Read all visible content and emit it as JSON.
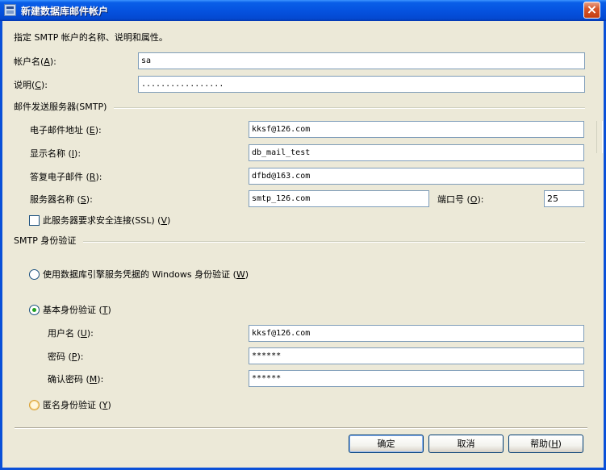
{
  "window": {
    "title": "新建数据库邮件帐户",
    "close_label": "×"
  },
  "intro": "指定 SMTP 帐户的名称、说明和属性。",
  "account": {
    "name_label": "帐户名",
    "name_key": "A",
    "name_value": "sa",
    "desc_label": "说明",
    "desc_key": "C",
    "desc_value": "................."
  },
  "smtp_server": {
    "group_title": "邮件发送服务器(SMTP)",
    "email_label": "电子邮件地址",
    "email_key": "E",
    "email_value": "kksf@126.com",
    "display_label": "显示名称",
    "display_key": "I",
    "display_value": "db_mail_test",
    "reply_label": "答复电子邮件",
    "reply_key": "R",
    "reply_value": "dfbd@163.com",
    "server_label": "服务器名称",
    "server_key": "S",
    "server_value": "smtp_126.com",
    "port_label": "端口号",
    "port_key": "O",
    "port_value": "25",
    "ssl_label": "此服务器要求安全连接(SSL)",
    "ssl_key": "V",
    "ssl_checked": false
  },
  "auth": {
    "group_title": "SMTP 身份验证",
    "windows_label": "使用数据库引擎服务凭据的 Windows 身份验证",
    "windows_key": "W",
    "basic_label": "基本身份验证",
    "basic_key": "T",
    "selected": "basic",
    "username_label": "用户名",
    "username_key": "U",
    "username_value": "kksf@126.com",
    "password_label": "密码",
    "password_key": "P",
    "password_value": "******",
    "confirm_label": "确认密码",
    "confirm_key": "M",
    "confirm_value": "******",
    "anonymous_label": "匿名身份验证",
    "anonymous_key": "Y"
  },
  "buttons": {
    "ok": "确定",
    "cancel": "取消",
    "help_label": "帮助",
    "help_key": "H"
  },
  "colors": {
    "title_bar": "#0553e0",
    "dialog_bg": "#ece9d8",
    "close_btn": "#d7572b",
    "radio_checked": "#21a121"
  }
}
